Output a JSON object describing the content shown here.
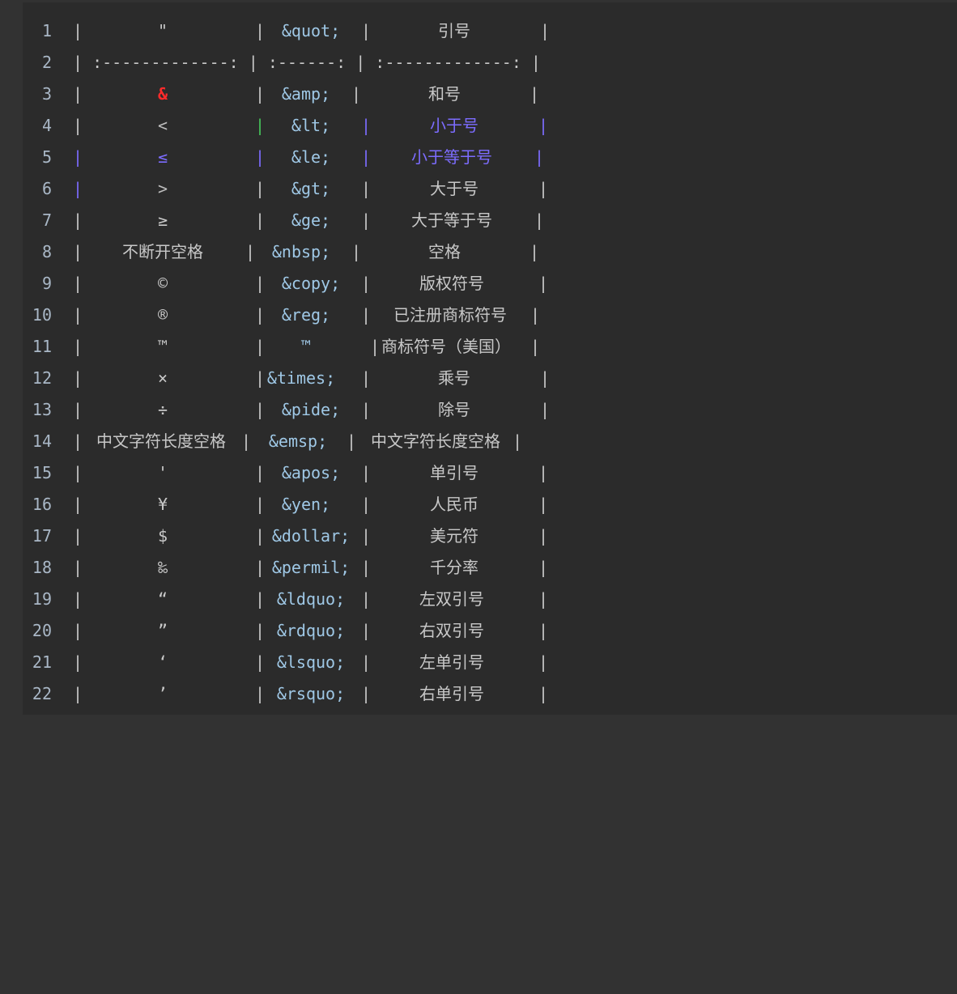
{
  "editor": {
    "lines": [
      {
        "n": "1",
        "char": "\"",
        "code": "&quot;",
        "desc": "引号"
      },
      {
        "n": "2",
        "sep": "| :-------------: | :------: | :-------------: |"
      },
      {
        "n": "3",
        "char": "&",
        "code": "&amp;",
        "desc": "和号"
      },
      {
        "n": "4",
        "char": "<",
        "code": "&lt;",
        "desc": "小于号"
      },
      {
        "n": "5",
        "char": "≤",
        "code": "&le;",
        "desc": "小于等于号"
      },
      {
        "n": "6",
        "char": ">",
        "code": "&gt;",
        "desc": "大于号"
      },
      {
        "n": "7",
        "char": "≥",
        "code": "&ge;",
        "desc": "大于等于号"
      },
      {
        "n": "8",
        "char": "不断开空格",
        "code": "&nbsp;",
        "desc": "空格"
      },
      {
        "n": "9",
        "char": "©",
        "code": "&copy;",
        "desc": "版权符号"
      },
      {
        "n": "10",
        "char": "®",
        "code": "&reg;",
        "desc": "已注册商标符号"
      },
      {
        "n": "11",
        "char": "™",
        "code": "™",
        "desc": "商标符号（美国）"
      },
      {
        "n": "12",
        "char": "×",
        "code": "&times;",
        "desc": "乘号"
      },
      {
        "n": "13",
        "char": "÷",
        "code": "&pide;",
        "desc": "除号"
      },
      {
        "n": "14",
        "char": "中文字符长度空格",
        "code": "&emsp;",
        "desc": "中文字符长度空格"
      },
      {
        "n": "15",
        "char": "'",
        "code": "&apos;",
        "desc": "单引号"
      },
      {
        "n": "16",
        "char": "¥",
        "code": "&yen;",
        "desc": "人民币"
      },
      {
        "n": "17",
        "char": "$",
        "code": "&dollar;",
        "desc": "美元符"
      },
      {
        "n": "18",
        "char": "‰",
        "code": "&permil;",
        "desc": "千分率"
      },
      {
        "n": "19",
        "char": "“",
        "code": "&ldquo;",
        "desc": "左双引号"
      },
      {
        "n": "20",
        "char": "”",
        "code": "&rdquo;",
        "desc": "右双引号"
      },
      {
        "n": "21",
        "char": "‘",
        "code": "&lsquo;",
        "desc": "左单引号"
      },
      {
        "n": "22",
        "char": "’",
        "code": "&rsquo;",
        "desc": "右单引号"
      }
    ],
    "pipe": "|"
  },
  "colors": {
    "background": "#2b2b2b",
    "gutter_text": "#a9b7c6",
    "code_text": "#9fc8e6",
    "highlight_red": "#ff2b2b",
    "highlight_purple": "#7c6cff",
    "highlight_green": "#46c45a"
  }
}
